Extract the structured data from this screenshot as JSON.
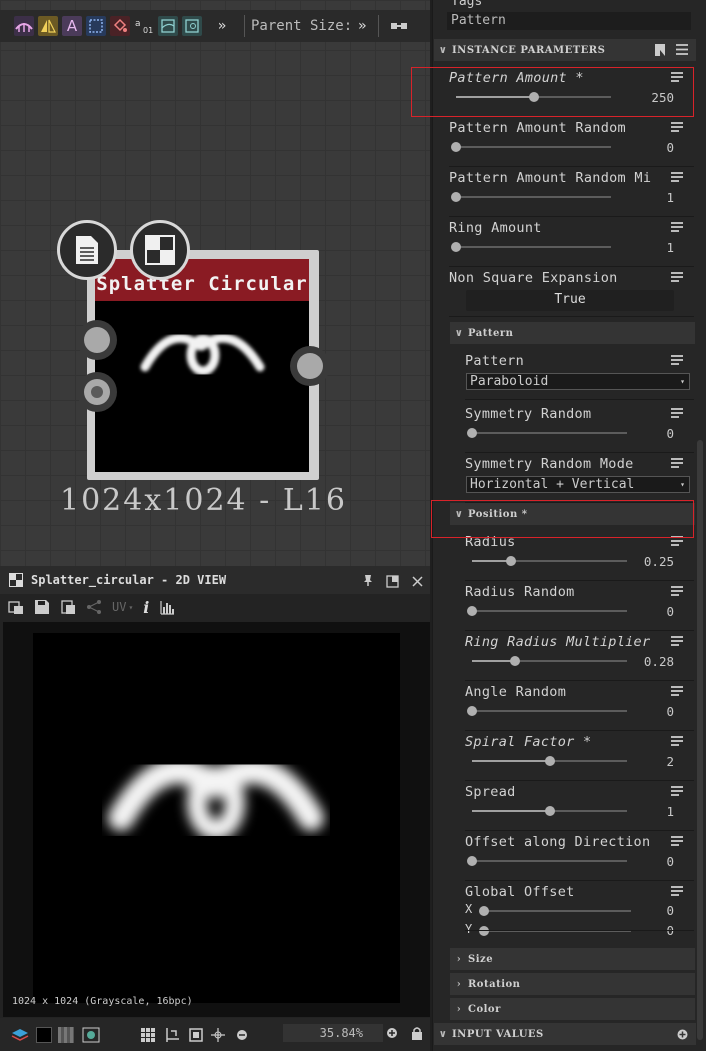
{
  "toolbar": {
    "parent_size_label": "Parent Size:",
    "more_label": "»",
    "parent_size_more": "»"
  },
  "node": {
    "title": "Splatter Circular",
    "resolution": "1024x1024 - L16"
  },
  "view": {
    "title": "Splatter_circular - 2D VIEW",
    "uv_label": "UV",
    "info": "1024 x 1024 (Grayscale, 16bpc)",
    "zoom": "35.84%"
  },
  "tags": {
    "label": "Tags",
    "value": "Pattern"
  },
  "sections": {
    "instance_parameters": "INSTANCE PARAMETERS",
    "pattern": "Pattern",
    "position": "Position *",
    "size": "Size",
    "rotation": "Rotation",
    "color": "Color",
    "input_values": "INPUT VALUES"
  },
  "params": {
    "pattern_amount": {
      "label": "Pattern Amount *",
      "value": "250",
      "fill": 0.5
    },
    "pattern_amount_random": {
      "label": "Pattern Amount Random",
      "value": "0",
      "fill": 0.0
    },
    "pattern_amount_random_min": {
      "label": "Pattern Amount Random Mi",
      "value": "1",
      "fill": 0.0
    },
    "ring_amount": {
      "label": "Ring Amount",
      "value": "1",
      "fill": 0.0
    },
    "non_square_expansion": {
      "label": "Non Square Expansion",
      "value": "True"
    },
    "pattern": {
      "label": "Pattern",
      "value": "Paraboloid"
    },
    "symmetry_random": {
      "label": "Symmetry Random",
      "value": "0",
      "fill": 0.0
    },
    "symmetry_random_mode": {
      "label": "Symmetry Random Mode",
      "value": "Horizontal + Vertical"
    },
    "radius": {
      "label": "Radius",
      "value": "0.25",
      "fill": 0.25
    },
    "radius_random": {
      "label": "Radius Random",
      "value": "0",
      "fill": 0.0
    },
    "ring_radius_multiplier": {
      "label": "Ring Radius Multiplier",
      "value": "0.28",
      "fill": 0.28
    },
    "angle_random": {
      "label": "Angle Random",
      "value": "0",
      "fill": 0.0
    },
    "spiral_factor": {
      "label": "Spiral Factor *",
      "value": "2",
      "fill": 0.5
    },
    "spread": {
      "label": "Spread",
      "value": "1",
      "fill": 0.5
    },
    "offset_along_direction": {
      "label": "Offset along Direction",
      "value": "0",
      "fill": 0.0
    },
    "global_offset": {
      "label": "Global Offset",
      "x_label": "X",
      "y_label": "Y",
      "x_value": "0",
      "y_value": "0"
    }
  },
  "colors": {
    "node_header": "#8a1b23",
    "highlight": "#d8232a"
  }
}
